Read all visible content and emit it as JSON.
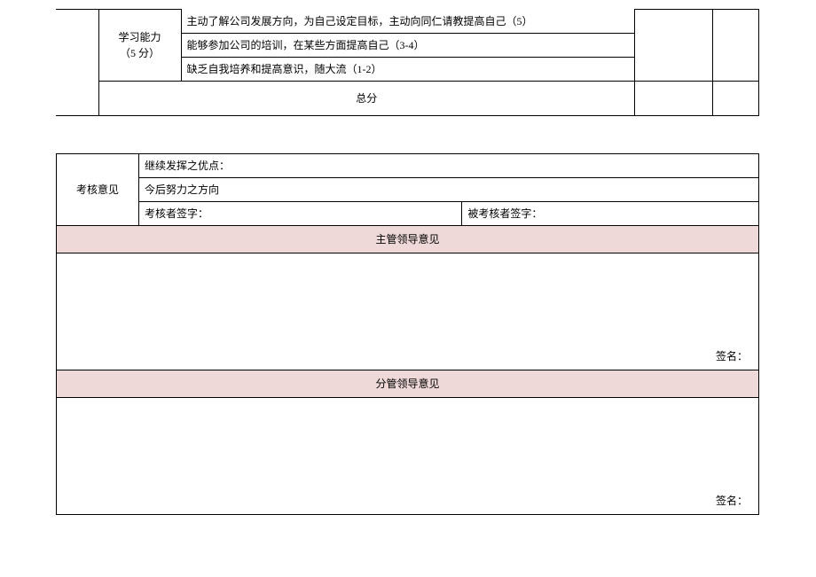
{
  "table1": {
    "row_label_line1": "学习能力",
    "row_label_line2": "（5 分）",
    "criteria": [
      "主动了解公司发展方向，为自己设定目标，主动向同仁请教提高自己（5）",
      "能够参加公司的培训，在某些方面提高自己（3-4）",
      "缺乏自我培养和提高意识，随大流（1-2）"
    ],
    "total_label": "总分"
  },
  "table2": {
    "opinion_label": "考核意见",
    "rows": {
      "strengths": "继续发挥之优点：",
      "direction": "今后努力之方向",
      "assessor_sign": "考核者签字：",
      "assessee_sign": "被考核者签字："
    },
    "supervisor_header": "主管领导意见",
    "deputy_header": "分管领导意见",
    "sign_label": "签名："
  }
}
